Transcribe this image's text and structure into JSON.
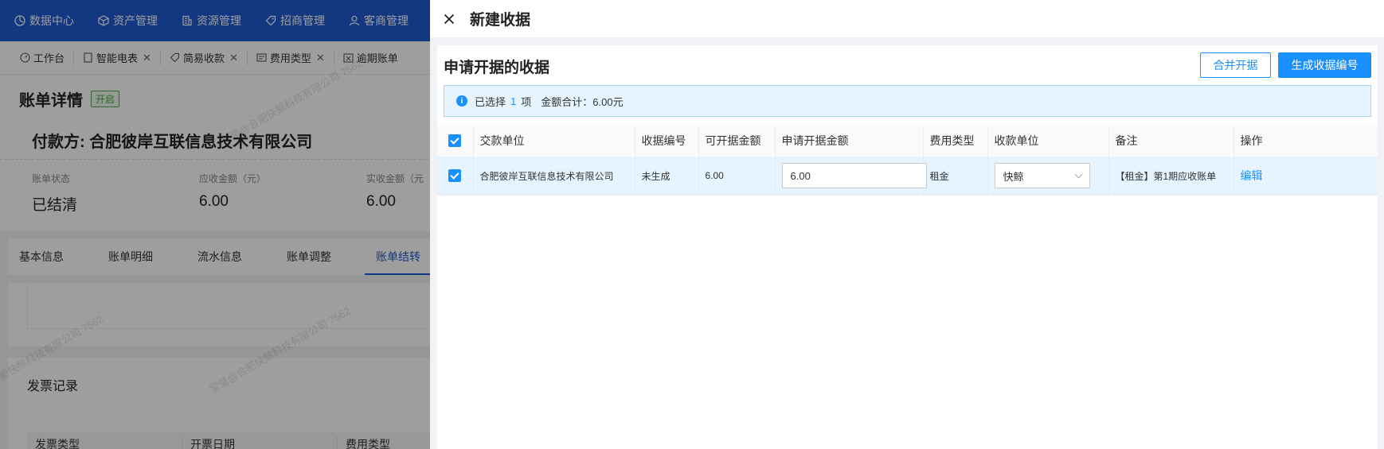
{
  "topnav": {
    "items": [
      {
        "label": "数据中心"
      },
      {
        "label": "资产管理"
      },
      {
        "label": "资源管理"
      },
      {
        "label": "招商管理"
      },
      {
        "label": "客商管理"
      }
    ]
  },
  "tabbar": {
    "tabs": [
      {
        "label": "工作台"
      },
      {
        "label": "智能电表"
      },
      {
        "label": "简易收款"
      },
      {
        "label": "费用类型"
      },
      {
        "label": "逾期账单"
      }
    ]
  },
  "bill": {
    "title": "账单详情",
    "status_badge": "开启",
    "payer": "付款方: 合肥彼岸互联信息技术有限公司",
    "stats": [
      {
        "label": "账单状态",
        "value": "已结清"
      },
      {
        "label": "应收金额（元）",
        "value": "6.00"
      },
      {
        "label": "实收金额（元",
        "value": "6.00"
      }
    ],
    "subtabs": [
      "基本信息",
      "账单明细",
      "流水信息",
      "账单调整",
      "账单结转"
    ],
    "invoice_title": "发票记录",
    "invoice_columns": [
      "发票类型",
      "开票日期",
      "费用类型"
    ],
    "watermark": "宝莹@合肥快鲸科技有限公司 7562"
  },
  "drawer": {
    "title": "新建收据",
    "section_title": "申请开据的收据",
    "merge_button": "合并开据",
    "generate_button": "生成收据编号",
    "alert": {
      "prefix": "已选择",
      "count": "1",
      "unit": "项",
      "total": "金额合计：6.00元"
    },
    "table": {
      "columns": [
        "交款单位",
        "收据编号",
        "可开据金额",
        "申请开据金额",
        "费用类型",
        "收款单位",
        "备注",
        "操作"
      ],
      "rows": [
        {
          "payer": "合肥彼岸互联信息技术有限公司",
          "receipt_no": "未生成",
          "available": "6.00",
          "apply_amount": "6.00",
          "fee_type": "租金",
          "receiver": "快鲸",
          "remark": "【租金】第1期应收账单",
          "action": "编辑"
        }
      ]
    }
  },
  "colors": {
    "nav_bg": "#1f5bd1",
    "primary": "#1890ff",
    "selected_row": "#e6f4ff",
    "badge_green": "#52a447"
  }
}
